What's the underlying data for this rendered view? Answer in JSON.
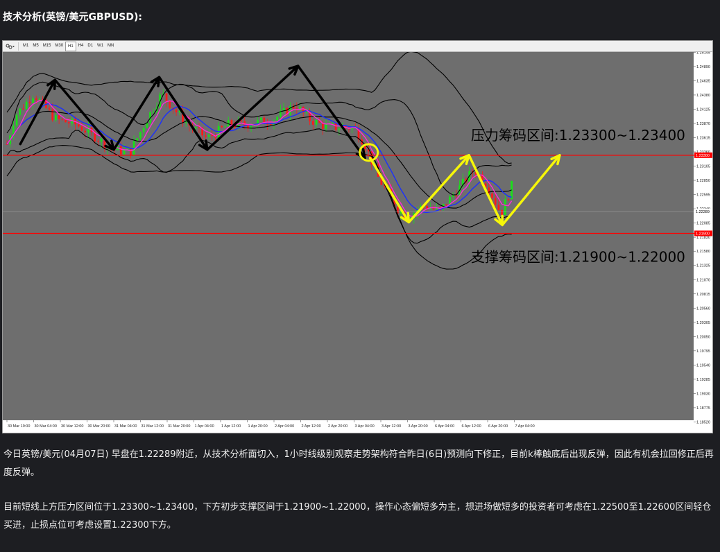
{
  "page": {
    "title": "技术分析(英镑/美元GBPUSD):",
    "paragraph1": "今日英镑/美元(04月07日) 早盘在1.22289附近，从技术分析面切入，1小时线级别观察走势架构符合昨日(6日)预测向下修正，目前k棒触底后出现反弹，因此有机会拉回修正后再度反弹。",
    "paragraph2": "目前短线上方压力区间位于1.23300~1.23400，下方初步支撑区间于1.21900~1.22000，操作心态偏短多为主，想进场做短多的投资者可考虑在1.22500至1.22600区间轻仓买进，止损点位可考虑设置1.22300下方。"
  },
  "toolbar": {
    "tool_icon": "crosshair-cursor-icon",
    "timeframes": [
      "M1",
      "M5",
      "M15",
      "M30",
      "H1",
      "H4",
      "D1",
      "W1",
      "MN"
    ],
    "active_timeframe": "H1"
  },
  "colors": {
    "chart_bg": "#6e6e6e",
    "bull_candle": "#19e019",
    "bear_candle": "#ff1a1a",
    "ma_blue": "#1a2fff",
    "ma_magenta": "#ff2ad9",
    "band": "#000000",
    "level_line": "#ff0000",
    "annotation_black": "#000000",
    "annotation_yellow": "#f6f609"
  },
  "chart_data": {
    "type": "candlestick",
    "instrument": "GBPUSD",
    "timeframe": "H1",
    "ylim": [
      1.1855,
      1.2515
    ],
    "y_ticks": [
      "1.25145",
      "1.24890",
      "1.24635",
      "1.24380",
      "1.24125",
      "1.23870",
      "1.23615",
      "1.23360",
      "1.23105",
      "1.22850",
      "1.22595",
      "1.22340",
      "1.22085",
      "1.21830",
      "1.21580",
      "1.21325",
      "1.21070",
      "1.20815",
      "1.20560",
      "1.20305",
      "1.20050",
      "1.19795",
      "1.19540",
      "1.19285",
      "1.19030",
      "1.18775",
      "1.18520"
    ],
    "x_ticks": [
      "30 Mar 19:00",
      "30 Mar 04:00",
      "30 Mar 12:00",
      "30 Mar 20:00",
      "31 Mar 04:00",
      "31 Mar 12:00",
      "31 Mar 20:00",
      "1 Apr 04:00",
      "1 Apr 12:00",
      "1 Apr 20:00",
      "2 Apr 04:00",
      "2 Apr 12:00",
      "2 Apr 20:00",
      "3 Apr 04:00",
      "3 Apr 12:00",
      "3 Apr 20:00",
      "6 Apr 04:00",
      "6 Apr 12:00",
      "6 Apr 20:00",
      "7 Apr 04:00"
    ],
    "current_price": "1.22289",
    "resistance_label_price": "1.23300",
    "support_label_price": "1.21900",
    "resistance_level": 1.233,
    "support_level": 1.219,
    "current_price_line": 1.2229,
    "resistance_text": "压力筹码区间:1.23300~1.23400",
    "support_text": "支撑筹码区间:1.21900~1.22000",
    "path_x_ticks": [
      {
        "x": 0.0,
        "ticks": [
          2,
          3.2,
          4.5,
          5.5
        ]
      },
      {
        "x": 0.75,
        "ticks": [
          4.0,
          5.5,
          6.5,
          7.5
        ]
      },
      {
        "x": 1.0,
        "ticks": [
          5.5,
          6.5,
          7.2,
          7.8
        ]
      },
      {
        "x": 1.8,
        "ticks": [
          6.8,
          8.0,
          9.0,
          10.0
        ]
      },
      {
        "x": 2.0,
        "ticks": [
          8.0,
          9.3,
          10.0,
          11.0
        ]
      },
      {
        "x": 2.8,
        "ticks": [
          10.0,
          11.0,
          12.0,
          13.0
        ]
      },
      {
        "x": 3.0,
        "ticks": [
          11.2,
          12.0,
          13.0,
          13.7
        ]
      },
      {
        "x": 3.8,
        "ticks": [
          13.0,
          14.2,
          15.0,
          16.0
        ]
      },
      {
        "x": 4.0,
        "ticks": [
          14.0,
          15.0,
          16.0,
          17.0
        ]
      },
      {
        "x": 4.8,
        "ticks": [
          16.0,
          17.0,
          18.0,
          19.0
        ]
      },
      {
        "x": 5.0,
        "ticks": [
          17.0,
          18.0,
          18.6,
          19.5
        ]
      }
    ],
    "path_y_ticks": [
      {
        "x": 1.0,
        "y": 1.242
      },
      {
        "x": 3.0,
        "y": 1.236
      },
      {
        "x": 4.5,
        "y": 1.241
      }
    ],
    "black_path": [
      {
        "x": 0.5,
        "y": 1.235
      },
      {
        "x": 1.8,
        "y": 1.2465
      },
      {
        "x": 4.0,
        "y": 1.234
      },
      {
        "x": 5.7,
        "y": 1.247
      },
      {
        "x": 7.5,
        "y": 1.234
      },
      {
        "x": 10.9,
        "y": 1.249
      },
      {
        "x": 13.4,
        "y": 1.2325
      }
    ],
    "yellow_path": [
      {
        "x": 13.6,
        "y": 1.2325
      },
      {
        "x": 15.05,
        "y": 1.221
      },
      {
        "x": 17.3,
        "y": 1.233
      },
      {
        "x": 18.55,
        "y": 1.2205
      },
      {
        "x": 20.7,
        "y": 1.233
      }
    ]
  }
}
